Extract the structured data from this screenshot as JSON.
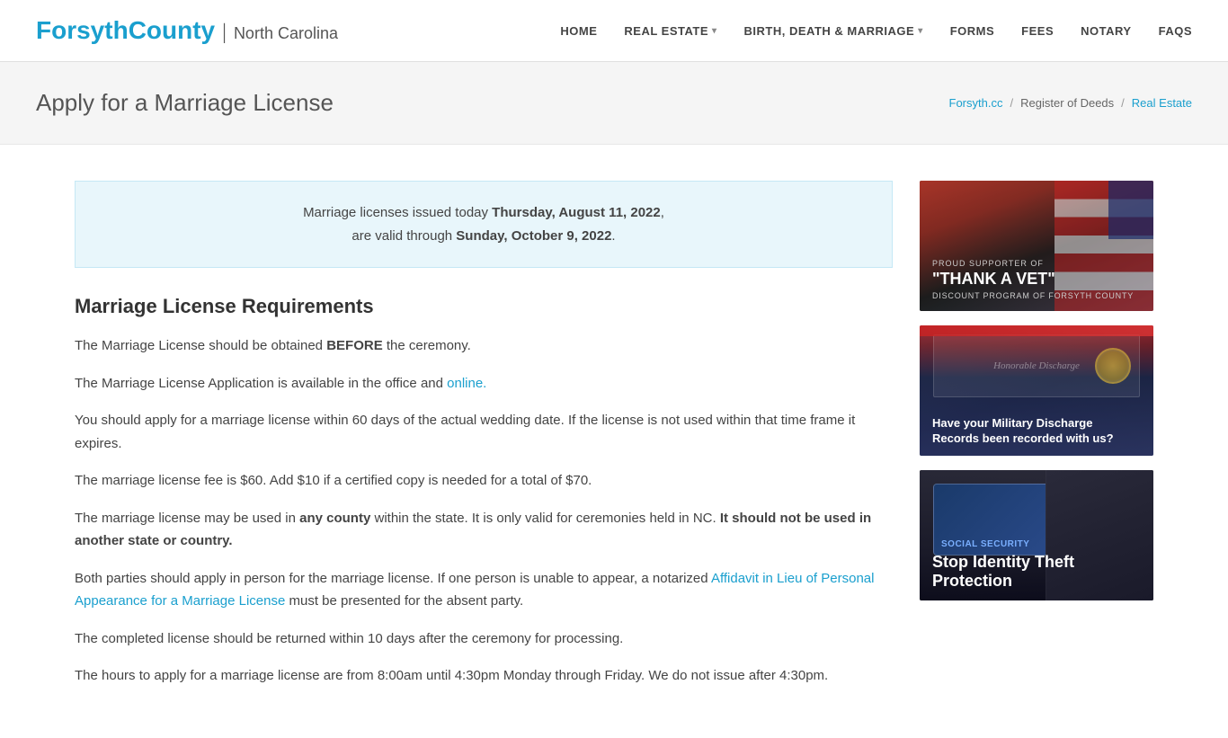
{
  "header": {
    "logo": {
      "forsyth": "Forsyth",
      "county": " County",
      "separator": "|",
      "nc": "North Carolina"
    },
    "nav": [
      {
        "id": "home",
        "label": "HOME",
        "hasDropdown": false
      },
      {
        "id": "real-estate",
        "label": "REAL ESTATE",
        "hasDropdown": true
      },
      {
        "id": "birth-death-marriage",
        "label": "BIRTH, DEATH & MARRIAGE",
        "hasDropdown": true
      },
      {
        "id": "forms",
        "label": "FORMS",
        "hasDropdown": false
      },
      {
        "id": "fees",
        "label": "FEES",
        "hasDropdown": false
      },
      {
        "id": "notary",
        "label": "NOTARY",
        "hasDropdown": false
      },
      {
        "id": "faqs",
        "label": "FAQS",
        "hasDropdown": false
      }
    ]
  },
  "breadcrumb": {
    "items": [
      {
        "label": "Forsyth.cc",
        "isLink": true,
        "isActive": false
      },
      {
        "label": "Register of Deeds",
        "isLink": false,
        "isActive": false
      },
      {
        "label": "Real Estate",
        "isLink": true,
        "isActive": true
      }
    ]
  },
  "page": {
    "title": "Apply for a Marriage License"
  },
  "notice": {
    "line1_prefix": "Marriage licenses issued today ",
    "line1_date": "Thursday, August 11, 2022",
    "line1_suffix": ",",
    "line2_prefix": "are valid through ",
    "line2_date": "Sunday, October 9, 2022",
    "line2_suffix": "."
  },
  "content": {
    "section_heading": "Marriage License Requirements",
    "paragraphs": [
      {
        "id": "para1",
        "text_before": "The Marriage License should be obtained ",
        "bold": "BEFORE",
        "text_after": " the ceremony.",
        "has_link": false
      },
      {
        "id": "para2",
        "text_before": "The Marriage License Application is available in the office and ",
        "link_text": "online.",
        "text_after": "",
        "has_link": true
      },
      {
        "id": "para3",
        "text": "You should apply for a marriage license within 60 days of the actual wedding date. If the license is not used within that time frame it expires.",
        "has_link": false
      },
      {
        "id": "para4",
        "text": "The marriage license fee is $60. Add $10 if a certified copy is needed for a total of $70.",
        "has_link": false
      },
      {
        "id": "para5",
        "text_before": "The marriage license may be used in ",
        "bold": "any county",
        "text_mid": " within the state. It is only valid for ceremonies held in NC. ",
        "bold2": "It should not be used in another state or country.",
        "has_link": false
      },
      {
        "id": "para6",
        "text_before": "Both parties should apply in person for the marriage license. If one person is unable to appear, a notarized ",
        "link_text": "Affidavit in Lieu of Personal Appearance for a Marriage License",
        "text_after": " must be presented for the absent party.",
        "has_link": true
      },
      {
        "id": "para7",
        "text": "The completed license should be returned within 10 days after the ceremony for processing.",
        "has_link": false
      },
      {
        "id": "para8",
        "text": "The hours to apply for a marriage license are from 8:00am until 4:30pm Monday through Friday. We do not issue after 4:30pm.",
        "has_link": false
      }
    ]
  },
  "sidebar": {
    "cards": [
      {
        "id": "thank-vet",
        "subtitle": "Proud Supporter of",
        "main_text": "\"THANK A VET\"",
        "detail": "Discount Program of Forsyth County"
      },
      {
        "id": "military-discharge",
        "heading": "Have your Military Discharge Records been recorded with us?"
      },
      {
        "id": "identity-theft",
        "heading": "Stop Identity Theft Protection"
      }
    ]
  }
}
